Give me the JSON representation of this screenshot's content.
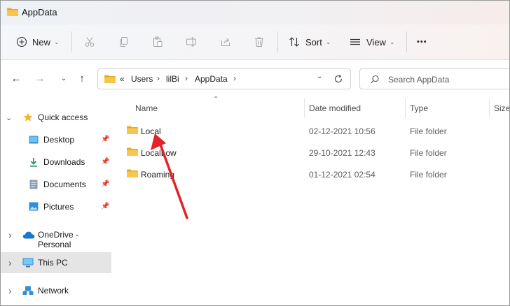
{
  "window": {
    "title": "AppData"
  },
  "toolbar": {
    "new_label": "New",
    "sort_label": "Sort",
    "view_label": "View",
    "more_label": "•••"
  },
  "address": {
    "overflow": "«",
    "crumbs": [
      "Users",
      "lilBi",
      "AppData"
    ]
  },
  "search": {
    "placeholder": "Search AppData"
  },
  "nav": {
    "quick_access": "Quick access",
    "desktop": "Desktop",
    "downloads": "Downloads",
    "documents": "Documents",
    "pictures": "Pictures",
    "onedrive": "OneDrive - Personal",
    "this_pc": "This PC",
    "network": "Network"
  },
  "columns": {
    "name": "Name",
    "date": "Date modified",
    "type": "Type",
    "size": "Size"
  },
  "files": [
    {
      "name": "Local",
      "date": "02-12-2021 10:56",
      "type": "File folder"
    },
    {
      "name": "LocalLow",
      "date": "29-10-2021 12:43",
      "type": "File folder"
    },
    {
      "name": "Roaming",
      "date": "01-12-2021 02:54",
      "type": "File folder"
    }
  ],
  "colors": {
    "folder": "#f3c24a",
    "annotation_arrow": "#e2232a",
    "accent": "#0067c0"
  }
}
